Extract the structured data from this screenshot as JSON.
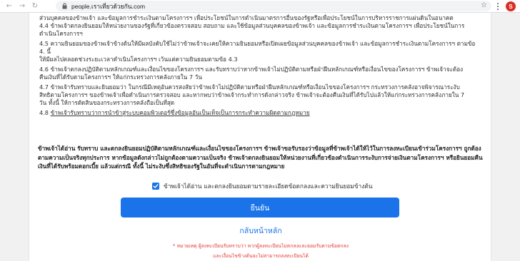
{
  "browser": {
    "url": "people.เราเที่ยวด้วยกัน.com",
    "avatar_letter": "S",
    "back_glyph": "←",
    "forward_glyph": "→",
    "reload_glyph": "↻",
    "star_glyph": "☆"
  },
  "terms": {
    "lines": [
      "ส่วนบุคคลของข้าพเจ้า และข้อมูลการชำระเงินตามโครงการฯ เพื่อประโยชน์ในการดำเนินมาตรการอื่นของรัฐหรือเพื่อประโยชน์ในการบริหารราชการแผ่นดินในอนาคต",
      "4.4 ข้าพเจ้าตกลงยินยอมให้หน่วยงานของรัฐที่เกี่ยวข้องตรวจสอบ สอบถาม และใช้ข้อมูลส่วนบุคคลของข้าพเจ้า และข้อมูลการชำระเงินตามโครงการฯ เพื่อประโยชน์ในการ",
      "ดำเนินโครงการฯ",
      "4.5 ความยินยอมของข้าพเจ้าข้างต้นให้มีผลบังคับใช้ไม่ว่าข้าพเจ้าจะเคยให้ความยินยอมหรือเปิดเผยข้อมูลส่วนบุคคลของข้าพเจ้า และข้อมูลการชำระเงินตามโครงการฯ ตามข้อ 4. นี้",
      "ให้มีผลไปตลอดช่วงระยะเวลาดำเนินโครงการฯ เว้นแต่ความยินยอมตามข้อ 4.3",
      "4.6 ข้าพเจ้าตกลงปฏิบัติตามหลักเกณฑ์และเงื่อนไขของโครงการฯ และรับทราบว่าหากข้าพเจ้าไม่ปฏิบัติตามหรือฝ่าฝืนหลักเกณฑ์หรือเงื่อนไขของโครงการฯ ข้าพเจ้าจะต้อง",
      "คืนเงินที่ได้รับตามโครงการฯ ให้แก่กระทรวงการคลังภายใน 7 วัน",
      "4.7 ข้าพเจ้ารับทราบและยินยอมว่า ในกรณีมีเหตุอันควรสงสัยว่าข้าพเจ้าไม่ปฏิบัติตามหรือฝ่าฝืนหลักเกณฑ์หรือเงื่อนไขของโครงการฯ กระทรวงการคลังอาจพิจารณาระงับ",
      "สิทธิตามโครงการฯ ของข้าพเจ้าเพื่อดำเนินการตรวจสอบ และหากพบว่าข้าพเจ้ากระทำการดังกล่าวจริง ข้าพเจ้าจะต้องคืนเงินที่ได้รับไปแล้วให้แก่กระทรวงการคลังภายใน 7",
      "วัน ทั้งนี้ ให้การตัดสินของกระทรวงการคลังถือเป็นที่สุด"
    ],
    "last_prefix": "4.8 ",
    "last_underlined": "ข้าพเจ้ารับทราบว่าการนำข้าสู่ระบบคอมพิวเตอร์ซึ่งข้อมูลอันเป็นเท็จเป็นการกระทำความผิดตามกฎหมาย"
  },
  "agreement": {
    "text": "ข้าพเจ้าได้อ่าน รับทราบ และตกลงยินยอมปฏิบัติตามหลักเกณฑ์และเงื่อนไขของโครงการฯ ข้าพเจ้าขอรับรองว่าข้อมูลที่ข้าพเจ้าได้ให้ไว้ในการลงทะเบียนเข้าร่วมโครงการฯ ถูกต้องตามความเป็นจริงทุกประการ หากข้อมูลดังกล่าวไม่ถูกต้องตามความเป็นจริง ข้าพเจ้าตกลงยินยอมให้หน่วยงานที่เกี่ยวข้องดำเนินการระงับการจ่ายเงินตามโครงการฯ หรือยินยอมคืนเงินที่ได้รับพร้อมดอกเบี้ย แล้วแต่กรณี ทั้งนี้ ไม่ระงับซึ่งสิทธิของรัฐในอันที่จะดำเนินการตามกฎหมาย"
  },
  "consent": {
    "checked": true,
    "label": "ข้าพเจ้าได้อ่าน และตกลงยินยอมตามรายละเอียดข้อตกลงและความยินยอมข้างต้น"
  },
  "actions": {
    "confirm_label": "ยืนยัน",
    "back_label": "กลับหน้าหลัก"
  },
  "note": {
    "line1": "* หมายเหตุ ผู้ลงทะเบียนรับทราบว่า หากผู้ลงทะเบียนไม่ตกลงและยอมรับตามข้อตกลง",
    "line2": "และเงื่อนไขข้างต้นจะไม่สามารถลงทะเบียนได้"
  },
  "colors": {
    "accent": "#1a73e8",
    "note_red": "#e53935",
    "avatar_red": "#d93025"
  }
}
